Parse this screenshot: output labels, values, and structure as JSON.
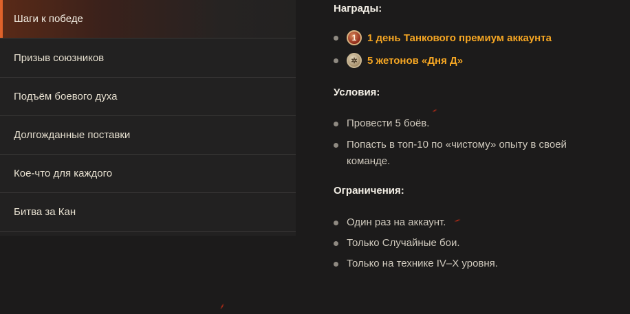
{
  "sidebar": {
    "items": [
      {
        "label": "Шаги к победе",
        "active": true
      },
      {
        "label": "Призыв союзников",
        "active": false
      },
      {
        "label": "Подъём боевого духа",
        "active": false
      },
      {
        "label": "Долгожданные поставки",
        "active": false
      },
      {
        "label": "Кое-что для каждого",
        "active": false
      },
      {
        "label": "Битва за Кан",
        "active": false
      }
    ]
  },
  "rewards": {
    "title": "Награды:",
    "items": [
      {
        "label": "1 день Танкового премиум аккаунта",
        "icon": "premium-coin-icon",
        "icon_text": "1"
      },
      {
        "label": "5 жетонов «Дня Д»",
        "icon": "token-coin-icon",
        "icon_text": "✲"
      }
    ]
  },
  "conditions": {
    "title": "Условия:",
    "items": [
      {
        "line1": "Провести 5 боёв.",
        "line2": ""
      },
      {
        "line1": "Попасть в топ-10 по «чистому» опыту в своей",
        "line2": "команде."
      }
    ]
  },
  "restrictions": {
    "title": "Ограничения:",
    "items": [
      "Один раз на аккаунт.",
      "Только Случайные бои.",
      "Только на технике IV–X уровня."
    ]
  },
  "colors": {
    "background": "#1c1b1b",
    "sidebar": "#222121",
    "accent": "#e0622a",
    "reward_text": "#f5a623"
  }
}
